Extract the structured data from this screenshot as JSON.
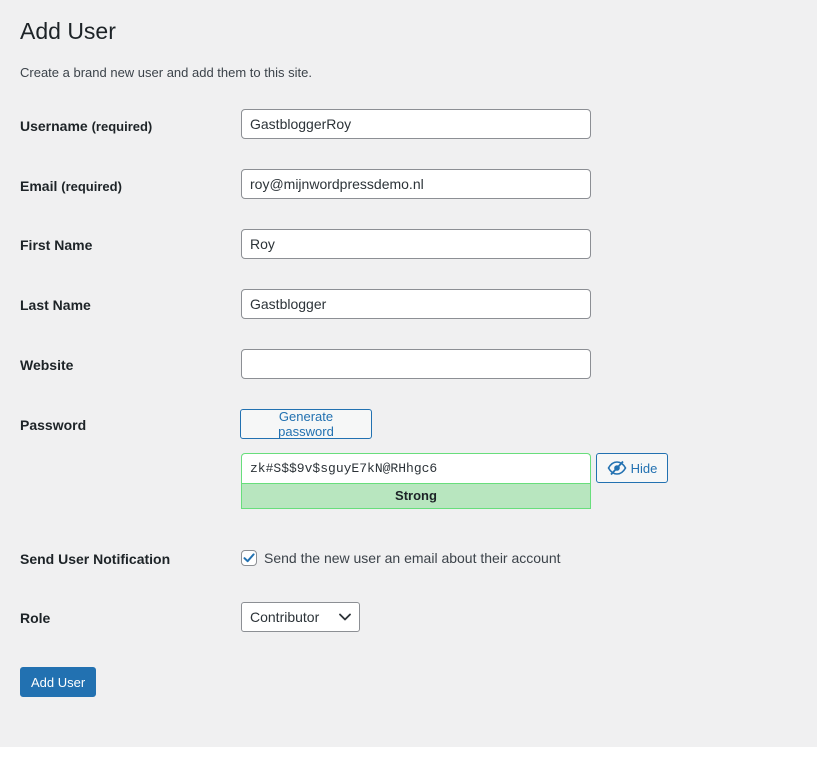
{
  "page": {
    "title": "Add User",
    "intro": "Create a brand new user and add them to this site."
  },
  "fields": {
    "username": {
      "label": "Username",
      "required": "(required)",
      "value": "GastbloggerRoy"
    },
    "email": {
      "label": "Email",
      "required": "(required)",
      "value": "roy@mijnwordpressdemo.nl"
    },
    "first_name": {
      "label": "First Name",
      "value": "Roy"
    },
    "last_name": {
      "label": "Last Name",
      "value": "Gastblogger"
    },
    "website": {
      "label": "Website",
      "value": ""
    }
  },
  "password": {
    "label": "Password",
    "generate_label": "Generate password",
    "value": "zk#S$$9v$sguyE7kN@RHhgc6",
    "hide_label": "Hide",
    "hide_icon": "eye-slash-icon",
    "strength": "Strong",
    "strength_color": "#b8e6bf"
  },
  "notification": {
    "label": "Send User Notification",
    "checkbox_label": "Send the new user an email about their account",
    "checked": true
  },
  "role": {
    "label": "Role",
    "selected": "Contributor"
  },
  "submit": {
    "label": "Add User",
    "color": "#2271b1"
  }
}
